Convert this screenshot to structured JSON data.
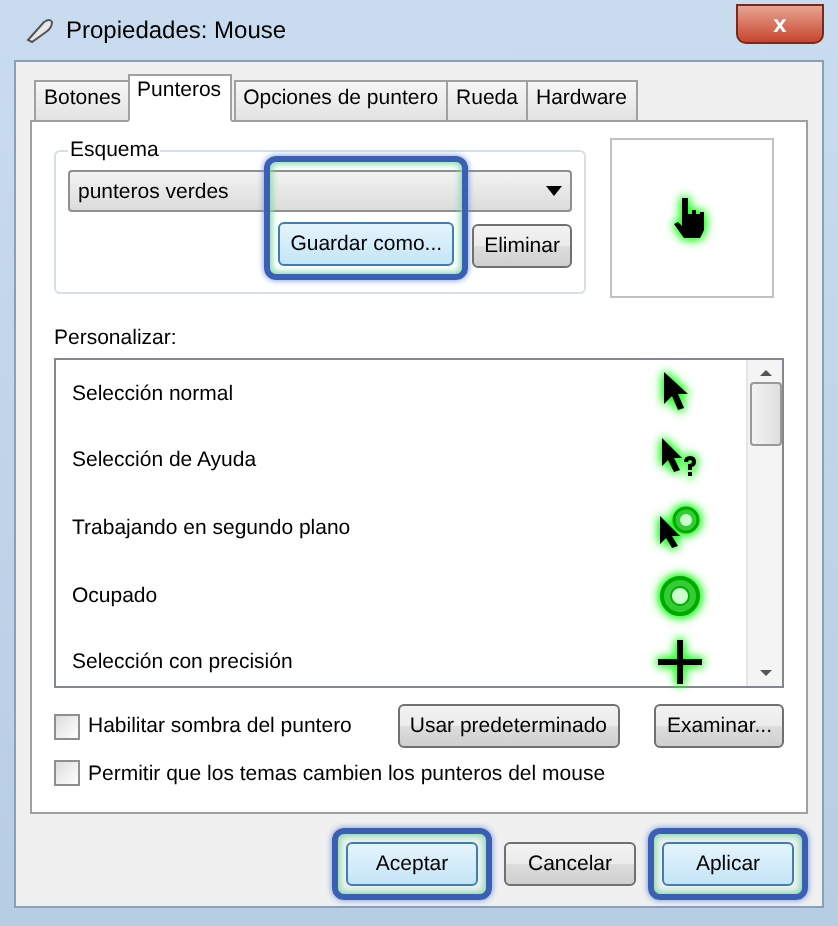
{
  "window": {
    "title": "Propiedades: Mouse",
    "close": "x"
  },
  "tabs": [
    {
      "label": "Botones",
      "selected": false
    },
    {
      "label": "Punteros",
      "selected": true
    },
    {
      "label": "Opciones de puntero",
      "selected": false
    },
    {
      "label": "Rueda",
      "selected": false
    },
    {
      "label": "Hardware",
      "selected": false
    }
  ],
  "scheme": {
    "label": "Esquema",
    "value": "punteros verdes",
    "buttons": [
      {
        "label": "Guardar como...",
        "highlighted": true
      },
      {
        "label": "Eliminar",
        "highlighted": false
      }
    ],
    "preview": {
      "kind": "hand"
    }
  },
  "customize": {
    "label": "Personalizar:",
    "items": [
      {
        "name": "Selección normal",
        "kind": "arrow"
      },
      {
        "name": "Selección de Ayuda",
        "kind": "help"
      },
      {
        "name": "Trabajando en segundo plano",
        "kind": "working"
      },
      {
        "name": "Ocupado",
        "kind": "busy"
      },
      {
        "name": "Selección con precisión",
        "kind": "cross"
      }
    ]
  },
  "options": [
    {
      "label": "Habilitar sombra del puntero",
      "checked": false
    },
    {
      "label": "Permitir que los temas cambien los punteros del mouse",
      "checked": false
    }
  ],
  "side_buttons": [
    "Usar predeterminado",
    "Examinar..."
  ],
  "buttons": [
    {
      "label": "Aceptar",
      "highlighted": true
    },
    {
      "label": "Cancelar",
      "highlighted": false
    },
    {
      "label": "Aplicar",
      "highlighted": true
    }
  ]
}
